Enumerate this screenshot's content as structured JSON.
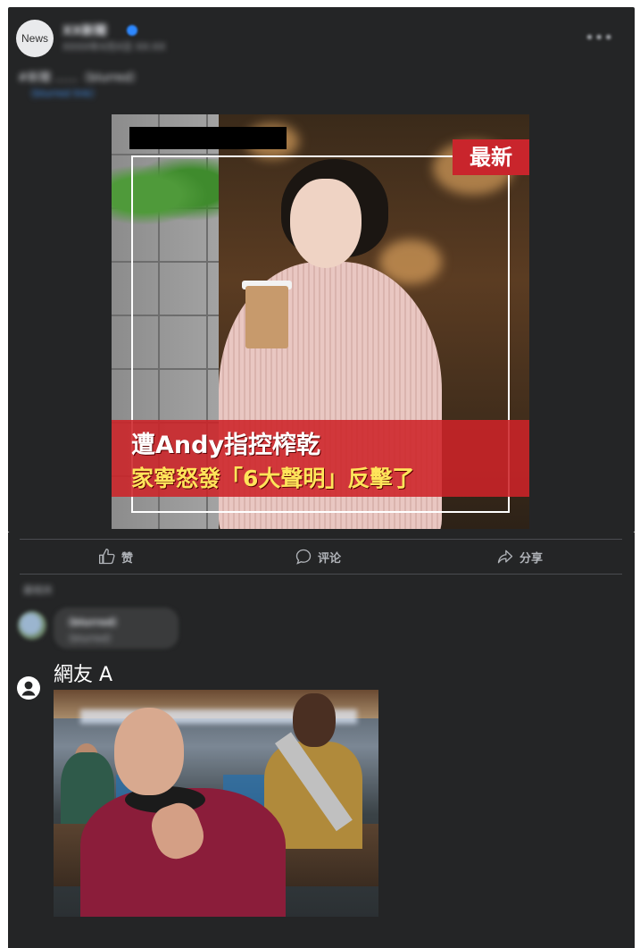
{
  "post": {
    "avatar_label": "News",
    "page_name": "XX新聞",
    "time": "XXXX年X月X日 XX:XX",
    "text": "#新聞 ……（blurred）",
    "link": "（blurred link）",
    "more_icon": "more-dots-icon"
  },
  "image": {
    "tag": "最新",
    "headline_line1": "遭Andy指控榨乾",
    "headline_line2": "家寧怒發「6大聲明」反擊了"
  },
  "actions": [
    {
      "label": "赞",
      "icon": "thumbs-up-icon"
    },
    {
      "label": "评论",
      "icon": "comment-icon"
    },
    {
      "label": "分享",
      "icon": "share-icon"
    }
  ],
  "comments": {
    "sort_label": "最相关",
    "first_comment": {
      "name": "（blurred）",
      "text": "（blurred）"
    }
  },
  "reply": {
    "user": "網友 A",
    "icon": "user-circle-icon"
  },
  "colors": {
    "panel": "#242526",
    "text": "#e4e6eb",
    "muted": "#b0b3b8",
    "accent_red": "#c9252c",
    "headline_yellow": "#ffe45a"
  }
}
